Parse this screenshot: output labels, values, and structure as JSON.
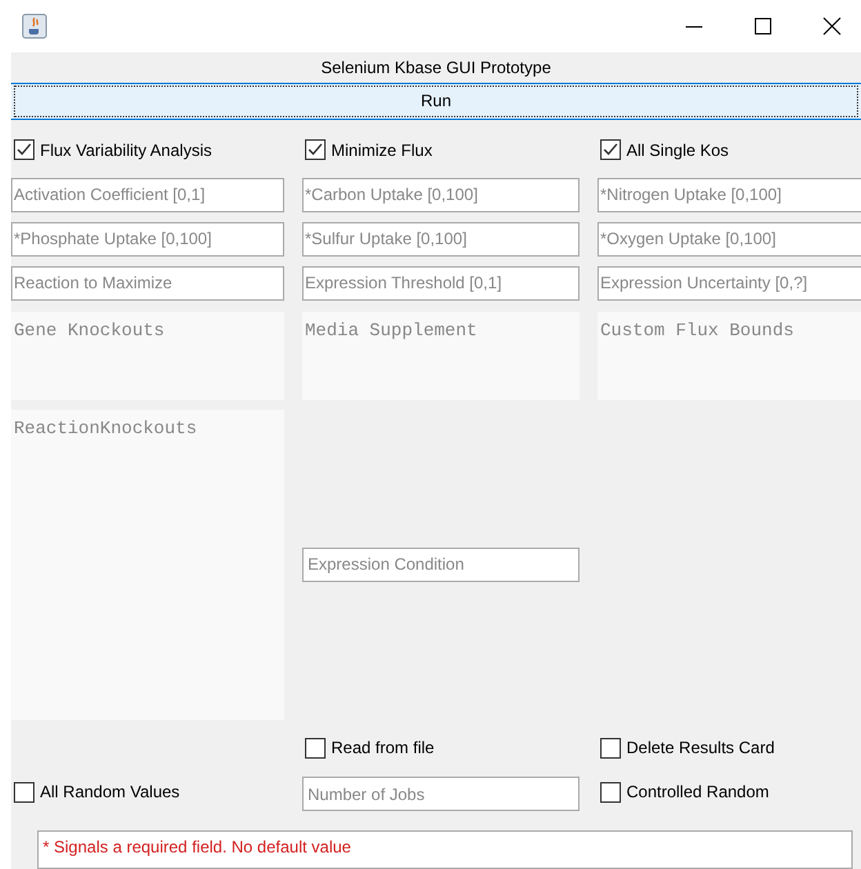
{
  "window": {
    "title": "Selenium Kbase GUI Prototype"
  },
  "run_button": {
    "label": "Run"
  },
  "options": [
    {
      "label": "Flux Variability Analysis",
      "checked": true
    },
    {
      "label": "Minimize Flux",
      "checked": true
    },
    {
      "label": "All Single Kos",
      "checked": true
    }
  ],
  "fields": [
    {
      "placeholder": "Activation Coefficient [0,1]"
    },
    {
      "placeholder": "*Carbon Uptake [0,100]"
    },
    {
      "placeholder": "*Nitrogen Uptake [0,100]"
    },
    {
      "placeholder": "*Phosphate Uptake [0,100]"
    },
    {
      "placeholder": "*Sulfur Uptake [0,100]"
    },
    {
      "placeholder": "*Oxygen Uptake [0,100]"
    },
    {
      "placeholder": "Reaction to Maximize"
    },
    {
      "placeholder": "Expression Threshold [0,1]"
    },
    {
      "placeholder": "Expression Uncertainty [0,?]"
    }
  ],
  "text_areas": [
    {
      "placeholder": "Gene Knockouts"
    },
    {
      "placeholder": "Media Supplement"
    },
    {
      "placeholder": "Custom Flux Bounds"
    }
  ],
  "reaction_knockouts": {
    "placeholder": "ReactionKnockouts"
  },
  "expression_condition": {
    "placeholder": "Expression Condition"
  },
  "read_from_file": {
    "label": "Read from file",
    "checked": false
  },
  "delete_results_card": {
    "label": "Delete Results Card",
    "checked": false
  },
  "all_random_values": {
    "label": "All Random Values",
    "checked": false
  },
  "number_of_jobs": {
    "placeholder": "Number of Jobs"
  },
  "controlled_random": {
    "label": "Controlled Random",
    "checked": false
  },
  "note": "* Signals a required field. No default value"
}
